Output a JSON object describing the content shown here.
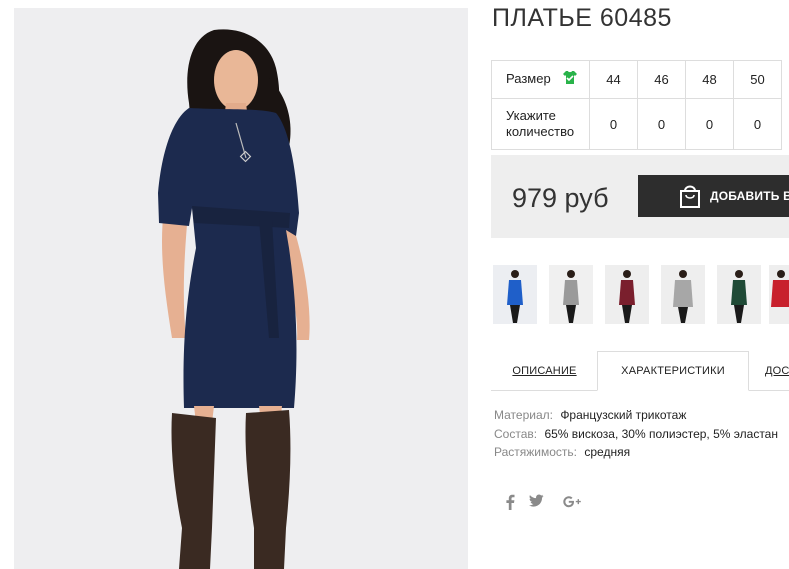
{
  "product": {
    "title": "ПЛАТЬЕ 60485",
    "price": "979 руб",
    "add_to_cart_label": "ДОБАВИТЬ В КОРЗИНУ"
  },
  "size_table": {
    "size_label": "Размер",
    "qty_label_line1": "Укажите",
    "qty_label_line2": "количество",
    "sizes": [
      "44",
      "46",
      "48",
      "50"
    ],
    "quantities": [
      "0",
      "0",
      "0",
      "0"
    ]
  },
  "thumbnails": [
    {
      "color": "#1f5fc9",
      "icon": "dress-thumbnail-blue"
    },
    {
      "color": "#9a9a9a",
      "icon": "dress-thumbnail-grey"
    },
    {
      "color": "#7a1f2d",
      "icon": "dress-thumbnail-burgundy"
    },
    {
      "color": "#a7a7a7",
      "icon": "dress-thumbnail-grey-melange"
    },
    {
      "color": "#1f4a36",
      "icon": "dress-thumbnail-green"
    },
    {
      "color": "#c8202c",
      "icon": "dress-thumbnail-red"
    }
  ],
  "tabs": [
    {
      "label": "ОПИСАНИЕ"
    },
    {
      "label": "ХАРАКТЕРИСТИКИ"
    },
    {
      "label": "ДОС"
    }
  ],
  "specs": [
    {
      "key": "Материал:",
      "value": "Французский трикотаж"
    },
    {
      "key": "Состав:",
      "value": "65% вискоза, 30% полиэстер, 5% эластан"
    },
    {
      "key": "Растяжимость:",
      "value": "средняя"
    }
  ],
  "social": [
    {
      "label": "f",
      "icon": "facebook-icon"
    },
    {
      "label": "twitter",
      "icon": "twitter-icon"
    },
    {
      "label": "g+",
      "icon": "google-plus-icon"
    }
  ],
  "colors": {
    "button_bg": "#2d2d2d",
    "price_panel_bg": "#eeeeee",
    "size_icon_green": "#29b34a",
    "dress_navy": "#1c2a4e"
  }
}
